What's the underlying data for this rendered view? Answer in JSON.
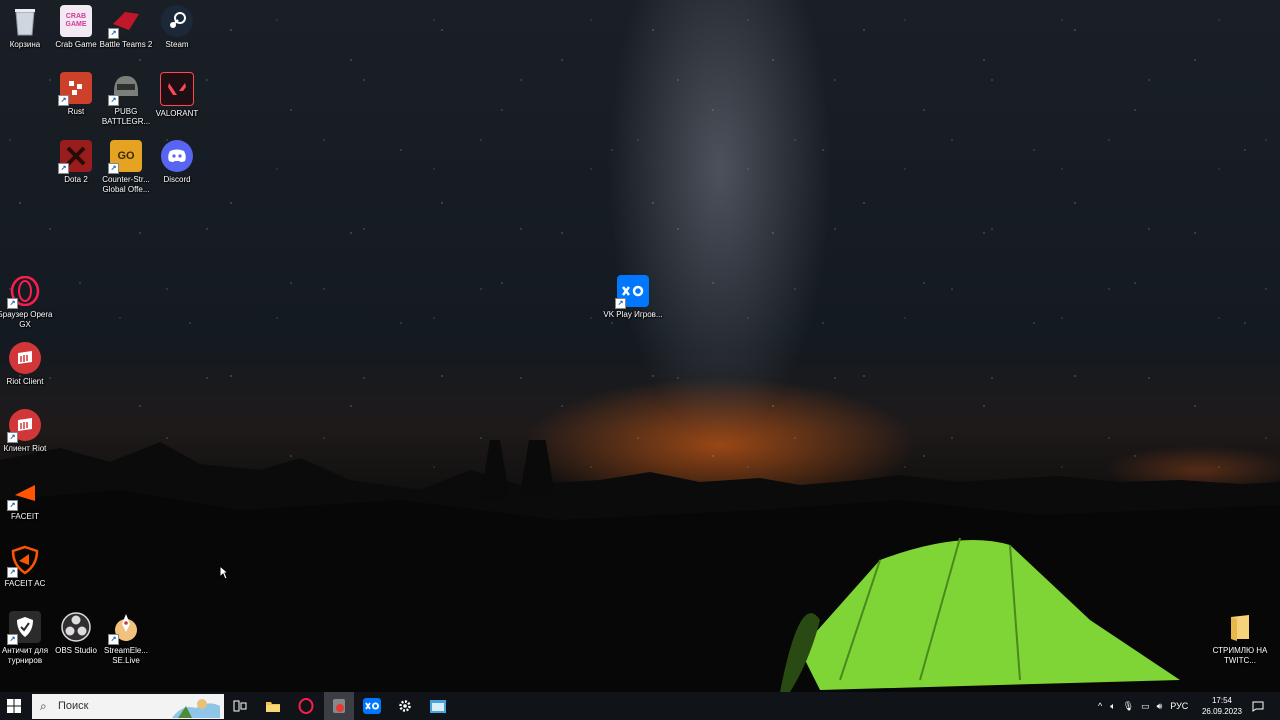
{
  "desktop_icons": {
    "recycle_bin": "Корзина",
    "crab_game": "Crab Game",
    "battle_teams": "Battle Teams 2",
    "steam": "Steam",
    "rust": "Rust",
    "pubg": "PUBG BATTLEGR...",
    "valorant": "VALORANT",
    "dota2": "Dota 2",
    "csgo": "Counter-Str... Global Offe...",
    "discord": "Discord",
    "vkplay": "VK Play Игров...",
    "opera_gx": "Браузер Opera GX",
    "riot_client": "Riot Client",
    "riot_client_ru": "Клиент Riot",
    "faceit": "FACEIT",
    "faceit_ac": "FACEIT AC",
    "anticheat": "Античит для турниров",
    "obs": "OBS Studio",
    "streamelements": "StreamEle... SE.Live",
    "folder": "СТРИМЛЮ НА TWITC..."
  },
  "icon_badges": {
    "crab_game": "CRAB GAME",
    "csgo": "GO"
  },
  "taskbar": {
    "search_placeholder": "Поиск",
    "language": "РУС",
    "time": "17:54",
    "date": "26.09.2023"
  },
  "colors": {
    "taskbar": "#101317",
    "steam": "#1b2838",
    "discord": "#5865f2",
    "valorant": "#ff4655",
    "riot": "#d13639",
    "vkplay": "#0077ff",
    "tent": "#8fe03a"
  }
}
